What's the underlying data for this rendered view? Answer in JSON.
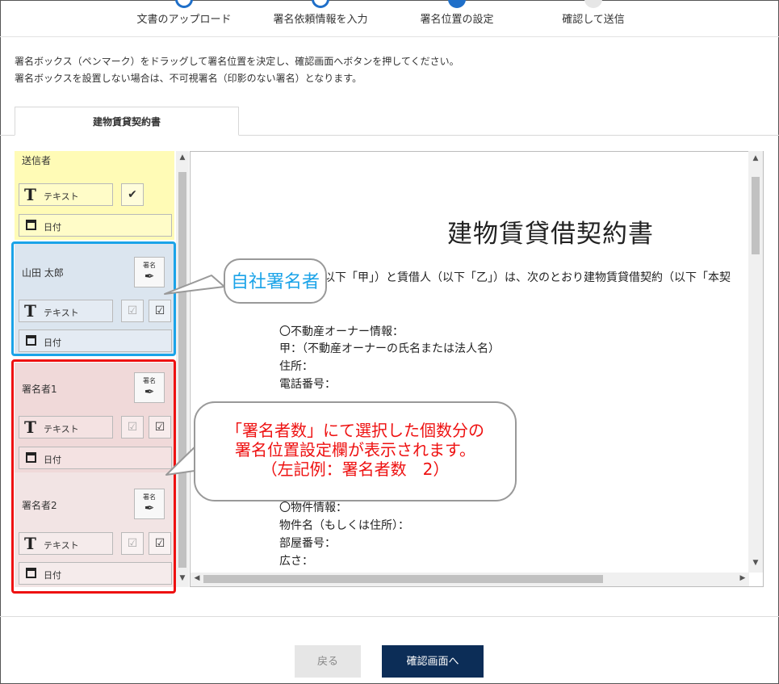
{
  "stepper": {
    "steps": [
      {
        "label": "文書のアップロード",
        "state": "done"
      },
      {
        "label": "署名依頼情報を入力",
        "state": "done"
      },
      {
        "label": "署名位置の設定",
        "state": "current"
      },
      {
        "label": "確認して送信",
        "state": "pending"
      }
    ]
  },
  "instructions": {
    "line1": "署名ボックス（ペンマーク）をドラッグして署名位置を決定し、確認画面へボタンを押してください。",
    "line2": "署名ボックスを設置しない場合は、不可視署名（印影のない署名）となります。"
  },
  "document_tab": "建物賃貸契約書",
  "signers": {
    "sender": {
      "name": "送信者",
      "text_label": "テキスト",
      "date_label": "日付"
    },
    "self": {
      "name": "山田 太郎",
      "text_label": "テキスト",
      "date_label": "日付",
      "sign_label": "署名"
    },
    "signer1": {
      "name": "署名者1",
      "text_label": "テキスト",
      "date_label": "日付",
      "sign_label": "署名"
    },
    "signer2": {
      "name": "署名者2",
      "text_label": "テキスト",
      "date_label": "日付",
      "sign_label": "署名"
    }
  },
  "document": {
    "title": "建物賃貸借契約書",
    "intro": "以下「甲」）と賃借人（以下「乙」）は、次のとおり建物賃貸借契約（以下「本契",
    "owner_heading": "〇不動産オーナー情報：",
    "owner_name": "甲：（不動産オーナーの氏名または法人名）",
    "owner_address": "住所：",
    "owner_phone": "電話番号：",
    "property_heading": "〇物件情報：",
    "property_name": "物件名（もしくは住所）：",
    "room_number": "部屋番号：",
    "area": "広さ："
  },
  "callouts": {
    "self_signer": "自社署名者",
    "signers_line1": "「署名者数」にて選択した個数分の",
    "signers_line2": "署名位置設定欄が表示されます。",
    "signers_line3": "（左記例：署名者数　2）"
  },
  "buttons": {
    "back": "戻る",
    "confirm": "確認画面へ"
  },
  "colors": {
    "accent": "#1f6fc9",
    "primary_button": "#0c2d57",
    "sender_bg": "#fffbb6",
    "self_bg": "#dbe5ef",
    "signer_bg": "#f0d9d9",
    "callout_blue": "#1aa3e8",
    "callout_red": "#ee1111"
  }
}
